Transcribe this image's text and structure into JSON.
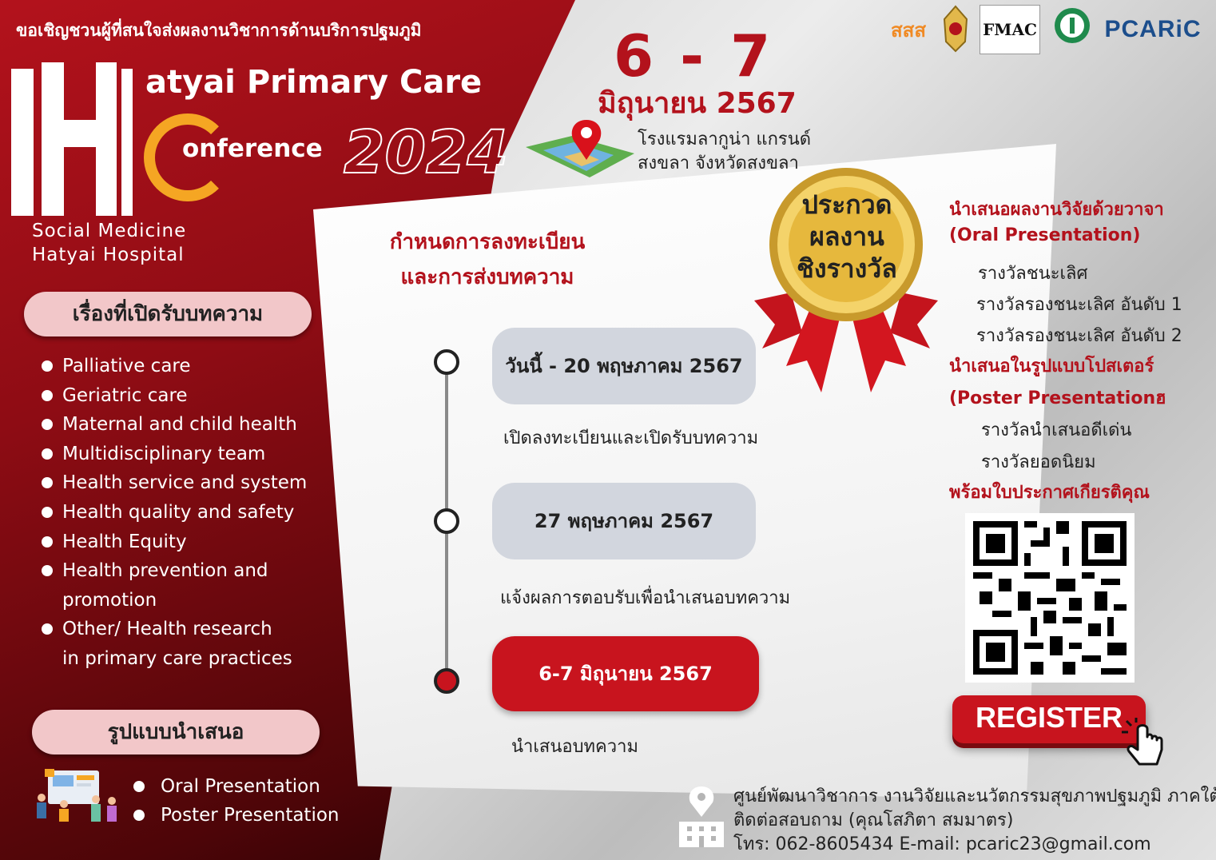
{
  "header": {
    "invite": "ขอเชิญชวนผู้ที่สนใจส่งผลงานวิชาการด้านบริการปฐมภูมิ",
    "title_line1": "atyai Primary Care",
    "title_line2": "onference",
    "title_year": "2024",
    "org_line1": "Social Medicine",
    "org_line2": "Hatyai Hospital"
  },
  "event": {
    "date_range": "6 - 7",
    "month_year": "มิถุนายน 2567",
    "venue_line1": "โรงแรมลากูน่า แกรนด์",
    "venue_line2": "สงขลา จังหวัดสงขลา"
  },
  "logos": [
    "สสส",
    "FMAC",
    "PCARiC"
  ],
  "topics": {
    "heading": "เรื่องที่เปิดรับบทความ",
    "items": [
      "Palliative care",
      "Geriatric care",
      "Maternal and child health",
      "Multidisciplinary team",
      "Health service and system",
      "Health quality and safety",
      "Health Equity",
      "Health prevention and",
      "promotion",
      "Other/ Health research",
      "in primary care practices"
    ]
  },
  "formats": {
    "heading": "รูปแบบนำเสนอ",
    "items": [
      "Oral Presentation",
      "Poster Presentation"
    ]
  },
  "schedule": {
    "heading_line1": "กำหนดการลงทะเบียน",
    "heading_line2": "และการส่งบทความ",
    "steps": [
      {
        "date": "วันนี้ - 20 พฤษภาคม 2567",
        "desc": "เปิดลงทะเบียนและเปิดรับบทความ"
      },
      {
        "date": "27 พฤษภาคม 2567",
        "desc": "แจ้งผลการตอบรับเพื่อนำเสนอบทความ"
      },
      {
        "date": "6-7 มิถุนายน 2567",
        "desc": "นำเสนอบทความ"
      }
    ]
  },
  "medal": {
    "line1": "ประกวด",
    "line2": "ผลงาน",
    "line3": "ชิงรางวัล"
  },
  "awards": {
    "oral_h1": "นำเสนอผลงานวิจัยด้วยวาจา",
    "oral_h2": "(Oral Presentation)",
    "oral_items": [
      "รางวัลชนะเลิศ",
      "รางวัลรองชนะเลิศ อันดับ 1",
      "รางวัลรองชนะเลิศ อันดับ 2"
    ],
    "poster_h1": "นำเสนอในรูปแบบโปสเตอร์",
    "poster_h2": "(Poster Presentationฮ",
    "poster_items": [
      "รางวัลนำเสนอดีเด่น",
      "รางวัลยอดนิยม"
    ],
    "certificate": "พร้อมใบประกาศเกียรติคุณ"
  },
  "register": {
    "label": "REGISTER"
  },
  "contact": {
    "line1": "ศูนย์พัฒนาวิชาการ งานวิจัยและนวัตกรรมสุขภาพปฐมภูมิ ภาคใต้",
    "line2": "ติดต่อสอบถาม (คุณโสภิตา สมมาตร)",
    "line3": "โทร: 062-8605434  E-mail: pcaric23@gmail.com"
  },
  "colors": {
    "brand_red": "#b3121c",
    "accent_orange": "#f5a623",
    "pill_pink": "#f2c7c9",
    "step_grey": "#d2d6de"
  }
}
